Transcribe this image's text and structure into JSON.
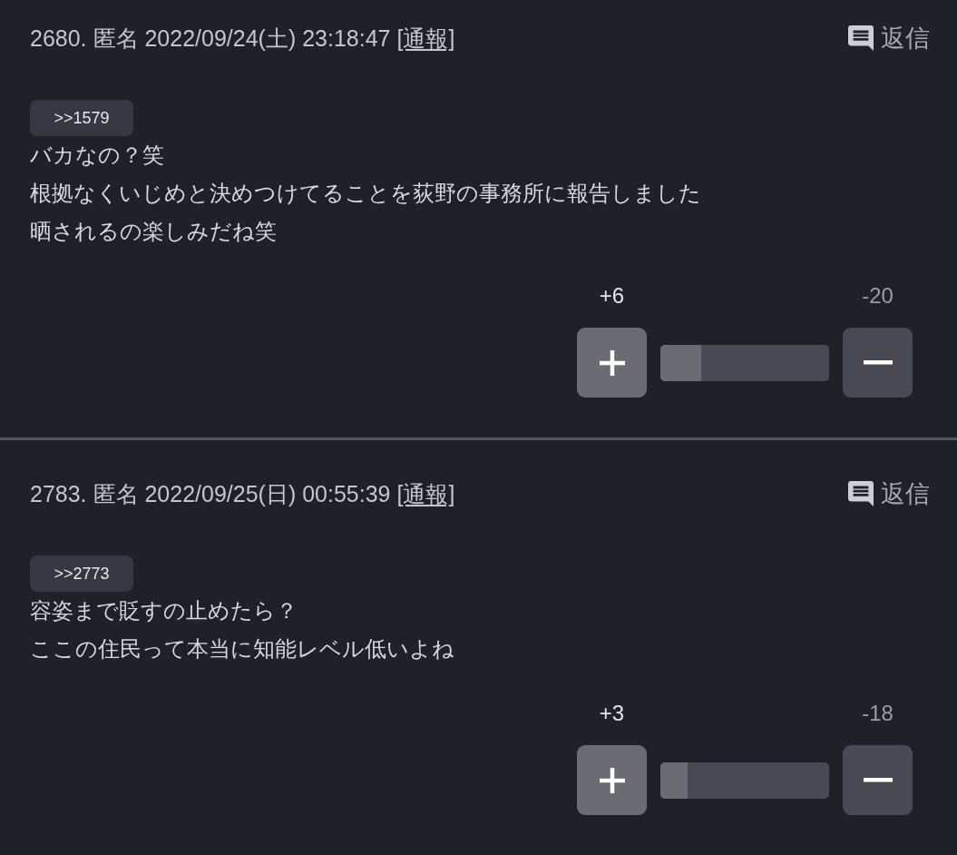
{
  "posts": [
    {
      "number": "2680.",
      "author": "匿名",
      "datetime": "2022/09/24(土) 23:18:47",
      "report_link": "[通報]",
      "reply_button": "返信",
      "anchor": ">>1579",
      "lines": [
        "バカなの？笑",
        "根拠なくいじめと決めつけてることを荻野の事務所に報告しました",
        "晒されるの楽しみだね笑"
      ],
      "votes": {
        "up_count": "+6",
        "down_count": "-20",
        "level": 0.24
      }
    },
    {
      "number": "2783.",
      "author": "匿名",
      "datetime": "2022/09/25(日) 00:55:39",
      "report_link": "[通報]",
      "reply_button": "返信",
      "anchor": ">>2773",
      "lines": [
        "容姿まで貶すの止めたら？",
        "ここの住民って本当に知能レベル低いよね"
      ],
      "votes": {
        "up_count": "+3",
        "down_count": "-18",
        "level": 0.16
      }
    }
  ]
}
